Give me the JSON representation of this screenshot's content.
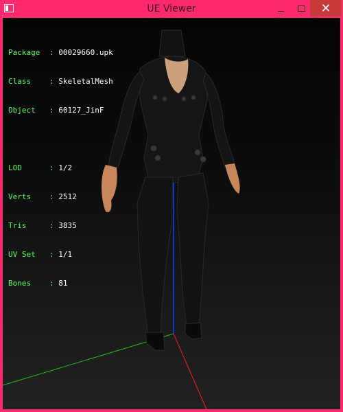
{
  "window": {
    "title": "UE Viewer",
    "close_glyph": "✕"
  },
  "info": {
    "block1": [
      {
        "key": "Package",
        "value": "00029660.upk"
      },
      {
        "key": "Class",
        "value": "SkeletalMesh"
      },
      {
        "key": "Object",
        "value": "60127_JinF"
      }
    ],
    "block2": [
      {
        "key": "LOD",
        "value": "1/2"
      },
      {
        "key": "Verts",
        "value": "2512"
      },
      {
        "key": "Tris",
        "value": "3835"
      },
      {
        "key": "UV Set",
        "value": "1/1"
      },
      {
        "key": "Bones",
        "value": "81"
      }
    ]
  },
  "colors": {
    "window_frame": "#ff2a6d",
    "label_green": "#55ff55",
    "axis_x": "#ff2020",
    "axis_y": "#20c020",
    "axis_z": "#2040ff"
  },
  "icons": {
    "app": "app-icon",
    "minimize": "minimize-icon",
    "maximize": "maximize-icon",
    "close": "close-icon"
  }
}
